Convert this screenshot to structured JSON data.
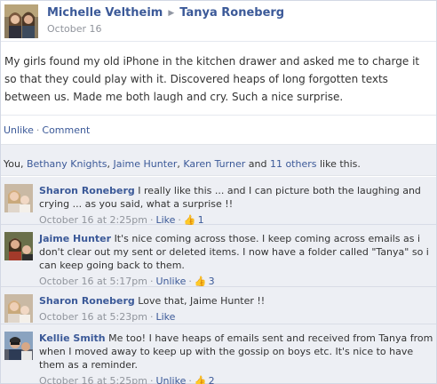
{
  "post": {
    "author": "Michelle Veltheim",
    "recipient": "Tanya Roneberg",
    "time": "October 16",
    "text": "My girls found my old iPhone in the kitchen drawer and asked me to charge it so that they could play with it. Discovered heaps of long forgotten texts between us. Made me both laugh and cry. Such a nice surprise.",
    "arrow_icon": "triangle-right-icon"
  },
  "actions": {
    "unlike_label": "Unlike",
    "separator": "·",
    "comment_label": "Comment"
  },
  "likes": {
    "you": "You, ",
    "person1": "Bethany Knights",
    "comma1": ", ",
    "person2": "Jaime Hunter",
    "comma2": ", ",
    "person3": "Karen Turner",
    "and": " and ",
    "others": "11 others",
    "suffix": " like this."
  },
  "comments": [
    {
      "author": "Sharon Roneberg",
      "text": "I really like this ... and I can picture both the laughing and crying ... as you said, what a surprise !!",
      "time": "October 16 at 2:25pm",
      "action": "Like",
      "like_count": "1"
    },
    {
      "author": "Jaime Hunter",
      "text": "It's nice coming across those. I keep coming across emails as i don't clear out my sent or deleted items. I now have a folder called \"Tanya\" so i can keep going back to them.",
      "time": "October 16 at 5:17pm",
      "action": "Unlike",
      "like_count": "3"
    },
    {
      "author": "Sharon Roneberg",
      "text": "Love that, Jaime Hunter !!",
      "time": "October 16 at 5:23pm",
      "action": "Like",
      "like_count": ""
    },
    {
      "author": "Kellie Smith",
      "text": "Me too! I have heaps of emails sent and received from Tanya from when I moved away to keep up with the gossip on boys etc. It's nice to have them as a reminder.",
      "time": "October 16 at 5:25pm",
      "action": "Unlike",
      "like_count": "2"
    }
  ],
  "colors": {
    "link": "#3b5998",
    "meta": "#90949c",
    "comment_bg": "#edeff4"
  }
}
